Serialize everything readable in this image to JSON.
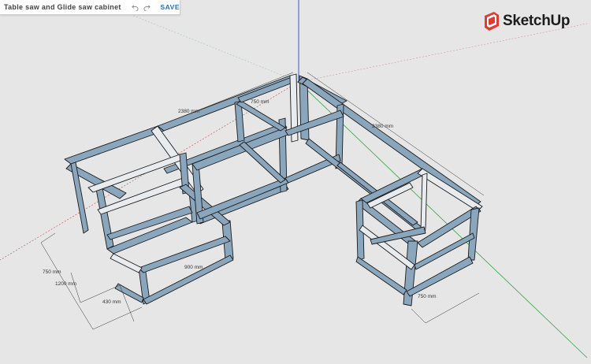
{
  "app": {
    "document_title": "Table saw and Glide saw cabinet",
    "save_label": "SAVE",
    "brand": "SketchUp",
    "undo_icon": "undo-icon",
    "redo_icon": "redo-icon"
  },
  "dimensions": {
    "top_left_length": "2380 mm",
    "top_right_length": "2380 mm",
    "short_depth": "750 mm",
    "left_height": "750 mm",
    "left_depth": "1200 mm",
    "left_width": "430 mm",
    "inner_span": "900 mm",
    "right_height": "750 mm"
  },
  "colors": {
    "canvas": "#e6e6e6",
    "frame_face": "#8aa6bd",
    "frame_light": "#e8ecef",
    "outline": "#1a1a1a",
    "save": "#1a73c8",
    "logo_red": "#e03c31"
  }
}
